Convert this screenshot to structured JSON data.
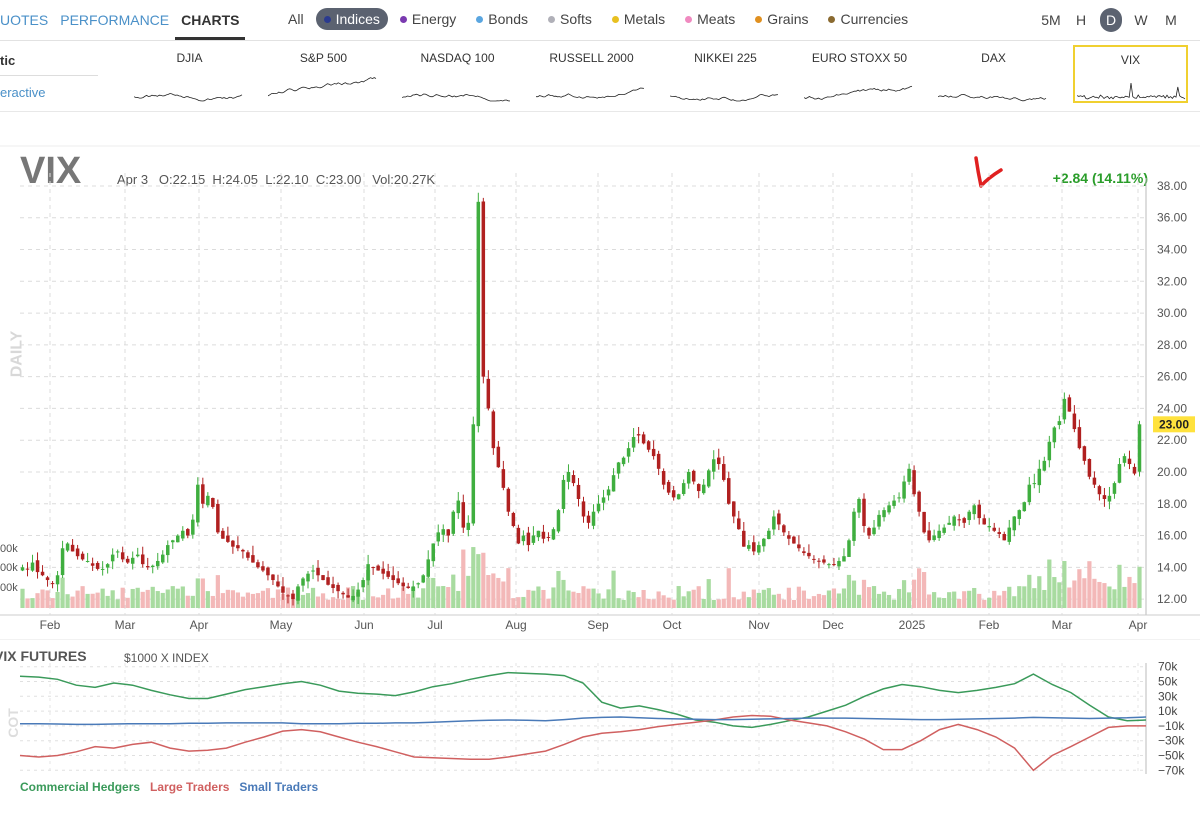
{
  "nav": {
    "tabs": [
      {
        "label": "UOTES",
        "active": false
      },
      {
        "label": "PERFORMANCE",
        "active": false
      },
      {
        "label": "CHARTS",
        "active": true
      }
    ],
    "categories": [
      {
        "label": "All",
        "color": null,
        "active": false
      },
      {
        "label": "Indices",
        "color": "#2a3a8f",
        "active": true
      },
      {
        "label": "Energy",
        "color": "#7a3ab0",
        "active": false
      },
      {
        "label": "Bonds",
        "color": "#5aa6e0",
        "active": false
      },
      {
        "label": "Softs",
        "color": "#b0b0b8",
        "active": false
      },
      {
        "label": "Metals",
        "color": "#e8c020",
        "active": false
      },
      {
        "label": "Meats",
        "color": "#f08ac0",
        "active": false
      },
      {
        "label": "Grains",
        "color": "#e09020",
        "active": false
      },
      {
        "label": "Currencies",
        "color": "#8a6a30",
        "active": false
      }
    ],
    "periods": [
      {
        "label": "5M",
        "active": false
      },
      {
        "label": "H",
        "active": false
      },
      {
        "label": "D",
        "active": true
      },
      {
        "label": "W",
        "active": false
      },
      {
        "label": "M",
        "active": false
      }
    ]
  },
  "side": {
    "item1": "tic",
    "item2": "eractive"
  },
  "minis": [
    {
      "label": "DJIA",
      "active": false
    },
    {
      "label": "S&P 500",
      "active": false
    },
    {
      "label": "NASDAQ 100",
      "active": false
    },
    {
      "label": "RUSSELL 2000",
      "active": false
    },
    {
      "label": "NIKKEI 225",
      "active": false
    },
    {
      "label": "EURO STOXX 50",
      "active": false
    },
    {
      "label": "DAX",
      "active": false
    },
    {
      "label": "VIX",
      "active": true
    }
  ],
  "header": {
    "symbol": "VIX",
    "date": "Apr 3",
    "open": "O:22.15",
    "high": "H:24.05",
    "low": "L:22.10",
    "close": "C:23.00",
    "volume": "Vol:20.27K",
    "change": "+2.84 (14.11%)",
    "last_price": "23.00",
    "interval_label": "DAILY"
  },
  "volume_labels": [
    "00k",
    "00k",
    "00k",
    "00k"
  ],
  "chart_data": [
    {
      "type": "candlestick",
      "title": "VIX",
      "ylim": [
        11,
        38.5
      ],
      "y_ticks": [
        "12.00",
        "14.00",
        "16.00",
        "18.00",
        "20.00",
        "22.00",
        "24.00",
        "26.00",
        "28.00",
        "30.00",
        "32.00",
        "34.00",
        "36.00",
        "38.00"
      ],
      "x_ticks": [
        "Feb",
        "Mar",
        "Apr",
        "May",
        "Jun",
        "Jul",
        "Aug",
        "Sep",
        "Oct",
        "Nov",
        "Dec",
        "2025",
        "Feb",
        "Mar",
        "Apr"
      ],
      "up_color": "#3fae3f",
      "down_color": "#b02020",
      "closes": [
        14.0,
        13.9,
        14.3,
        13.7,
        13.5,
        13.2,
        13.0,
        13.5,
        15.2,
        15.5,
        15.0,
        14.7,
        14.5,
        14.4,
        14.1,
        13.9,
        13.9,
        14.2,
        14.8,
        15.0,
        14.5,
        14.3,
        14.6,
        14.8,
        14.2,
        14.0,
        14.1,
        14.4,
        14.8,
        15.4,
        15.7,
        16.0,
        16.3,
        16.0,
        17.0,
        19.2,
        18.0,
        18.5,
        17.8,
        16.2,
        15.8,
        15.6,
        15.3,
        15.2,
        15.0,
        14.6,
        14.3,
        14.0,
        13.8,
        13.5,
        13.2,
        12.8,
        12.4,
        12.2,
        12.0,
        12.8,
        13.3,
        13.6,
        13.8,
        13.5,
        13.2,
        12.9,
        12.7,
        12.5,
        12.3,
        12.1,
        12.2,
        12.6,
        13.2,
        14.2,
        14.0,
        13.8,
        13.6,
        13.4,
        13.2,
        13.0,
        12.8,
        12.7,
        12.8,
        13.0,
        13.5,
        14.5,
        15.5,
        16.2,
        16.4,
        16.0,
        17.5,
        18.2,
        16.5,
        16.8,
        23.0,
        37.0,
        26.0,
        24.0,
        21.5,
        20.3,
        19.0,
        17.5,
        16.6,
        15.5,
        16.0,
        15.4,
        16.0,
        16.3,
        15.8,
        15.9,
        16.4,
        17.6,
        19.5,
        20.0,
        19.3,
        18.3,
        17.2,
        16.8,
        17.5,
        18.0,
        18.4,
        18.9,
        19.8,
        20.6,
        20.9,
        21.5,
        22.2,
        22.3,
        21.8,
        21.4,
        21.0,
        20.2,
        19.2,
        18.7,
        18.4,
        18.6,
        19.3,
        20.0,
        19.4,
        18.8,
        19.2,
        20.1,
        20.8,
        20.5,
        19.5,
        18.0,
        17.2,
        16.4,
        15.3,
        15.4,
        15.0,
        15.4,
        15.8,
        16.3,
        17.2,
        16.7,
        16.2,
        15.8,
        15.5,
        15.2,
        14.9,
        14.7,
        14.5,
        14.4,
        14.3,
        14.2,
        14.2,
        14.4,
        14.7,
        15.7,
        17.5,
        18.3,
        16.6,
        16.0,
        16.5,
        17.3,
        17.6,
        17.9,
        18.2,
        18.4,
        19.4,
        20.2,
        18.6,
        17.5,
        16.2,
        15.7,
        16.0,
        16.3,
        16.5,
        16.8,
        17.2,
        17.0,
        16.8,
        17.5,
        17.9,
        17.1,
        16.7,
        16.6,
        16.3,
        16.1,
        15.7,
        16.5,
        17.2,
        17.6,
        18.1,
        19.2,
        19.3,
        20.2,
        20.7,
        21.9,
        22.8,
        23.2,
        24.6,
        23.8,
        22.7,
        21.5,
        20.7,
        19.7,
        19.2,
        18.6,
        18.3,
        18.5,
        19.3,
        20.5,
        21.0,
        20.5,
        19.9,
        23.0
      ]
    },
    {
      "type": "line",
      "title": "VIX FUTURES",
      "ylabel": "$1000 X INDEX",
      "y_ticks": [
        "70k",
        "50k",
        "30k",
        "10k",
        "−10k",
        "−30k",
        "−50k",
        "−70k"
      ],
      "ylim": [
        -75000,
        75000
      ],
      "series": [
        {
          "name": "Commercial Hedgers",
          "color": "#3a9a5a",
          "values": [
            57000,
            56000,
            53000,
            45000,
            42000,
            48000,
            45000,
            38000,
            32000,
            27000,
            27000,
            33000,
            39000,
            43000,
            47000,
            50000,
            45000,
            37000,
            34000,
            33000,
            31000,
            36000,
            43000,
            47000,
            53000,
            58000,
            62000,
            61000,
            60000,
            58000,
            48000,
            22000,
            14000,
            17000,
            12000,
            6000,
            -2000,
            -5000,
            -10000,
            -12000,
            -8000,
            -3000,
            2000,
            10000,
            18000,
            30000,
            40000,
            46000,
            43000,
            38000,
            35000,
            38000,
            42000,
            47000,
            60000,
            46000,
            35000,
            18000,
            2000,
            -3000,
            -2000
          ]
        },
        {
          "name": "Large Traders",
          "color": "#d06060",
          "values": [
            -50000,
            -52000,
            -50000,
            -45000,
            -38000,
            -40000,
            -35000,
            -32000,
            -40000,
            -44000,
            -43000,
            -40000,
            -32000,
            -25000,
            -17000,
            -15000,
            -18000,
            -25000,
            -32000,
            -38000,
            -45000,
            -52000,
            -53000,
            -54000,
            -55000,
            -55000,
            -52000,
            -48000,
            -44000,
            -35000,
            -25000,
            -20000,
            -18000,
            -15000,
            -11000,
            -8000,
            -5000,
            -2000,
            2000,
            4000,
            3000,
            -2000,
            -6000,
            -10000,
            -18000,
            -28000,
            -42000,
            -42000,
            -30000,
            -15000,
            -8000,
            -15000,
            -25000,
            -40000,
            -70000,
            -50000,
            -38000,
            -25000,
            -12000,
            -10000,
            -10000
          ]
        },
        {
          "name": "Small Traders",
          "color": "#4a7ab8",
          "values": [
            -7000,
            -7000,
            -7500,
            -8000,
            -8000,
            -7500,
            -7000,
            -7000,
            -7000,
            -6500,
            -6500,
            -6000,
            -6000,
            -6000,
            -6000,
            -7000,
            -7000,
            -7000,
            -6500,
            -6500,
            -6000,
            -6000,
            -5000,
            -4000,
            -3000,
            -2500,
            -2000,
            -2500,
            -3000,
            -1500,
            500,
            1500,
            2000,
            1000,
            0,
            -500,
            -1000,
            -1500,
            -1500,
            -1000,
            -500,
            0,
            500,
            500,
            500,
            0,
            -500,
            -1000,
            -1500,
            -1500,
            -1000,
            -500,
            0,
            500,
            1500,
            1000,
            500,
            0,
            500,
            1000,
            2000
          ]
        }
      ]
    }
  ]
}
